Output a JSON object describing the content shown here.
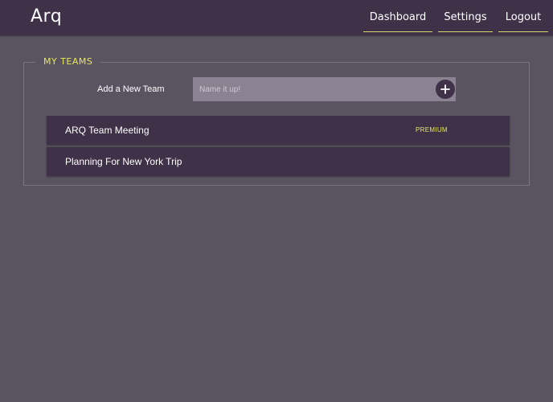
{
  "header": {
    "logo": "Arq",
    "nav": {
      "dashboard": "Dashboard",
      "settings": "Settings",
      "logout": "Logout"
    }
  },
  "teams_panel": {
    "title": "MY TEAMS",
    "add_label": "Add a New Team",
    "input_placeholder": "Name it up!",
    "input_value": "",
    "add_button_icon": "plus-icon",
    "teams": [
      {
        "name": "ARQ Team Meeting",
        "badge": "PREMIUM"
      },
      {
        "name": "Planning For New York Trip",
        "badge": ""
      }
    ]
  },
  "colors": {
    "background": "#5a5460",
    "header": "#3f3147",
    "accent": "#e6e85a",
    "input": "#8b8391"
  }
}
